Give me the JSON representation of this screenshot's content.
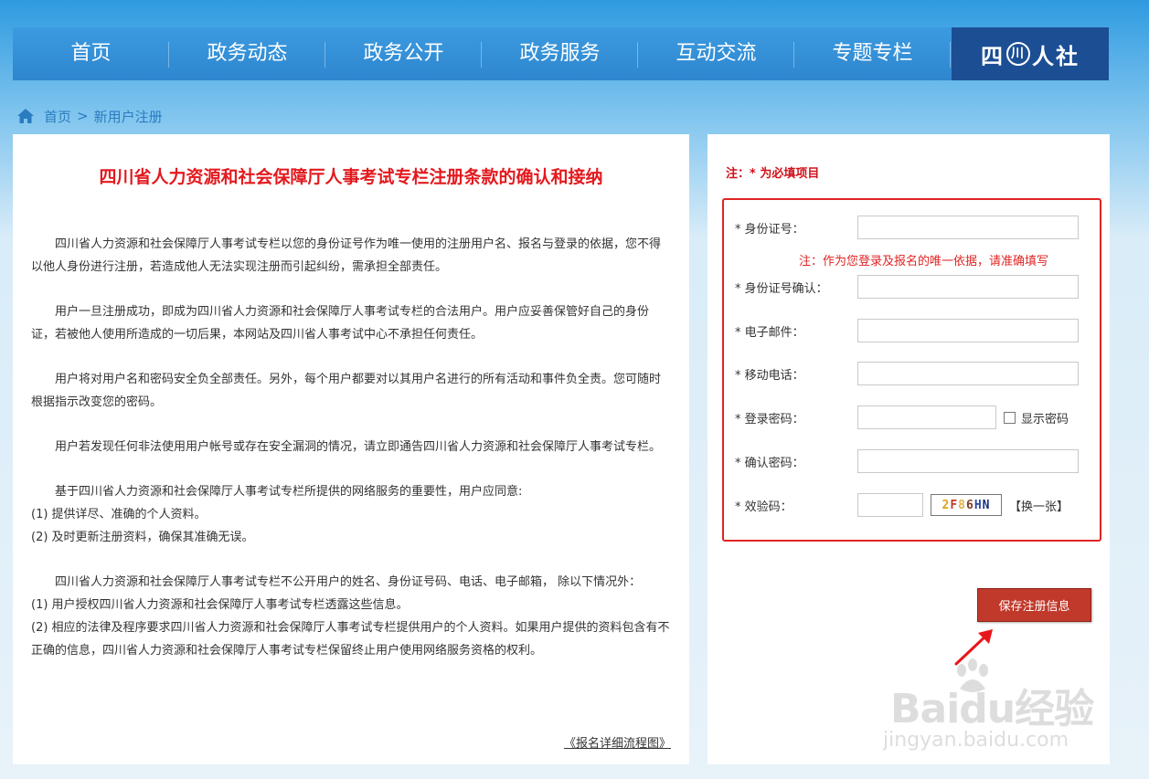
{
  "nav": {
    "items": [
      "首页",
      "政务动态",
      "政务公开",
      "政务服务",
      "互动交流",
      "专题专栏"
    ],
    "logo": {
      "pre": "四",
      "ring": "川",
      "post": "人社"
    }
  },
  "breadcrumb": {
    "home": "首页",
    "sep": ">",
    "current": "新用户注册"
  },
  "terms": {
    "title": "四川省人力资源和社会保障厅人事考试专栏注册条款的确认和接纳",
    "p1": "四川省人力资源和社会保障厅人事考试专栏以您的身份证号作为唯一使用的注册用户名、报名与登录的依据，您不得以他人身份进行注册，若造成他人无法实现注册而引起纠纷，需承担全部责任。",
    "p2": "用户一旦注册成功，即成为四川省人力资源和社会保障厅人事考试专栏的合法用户。用户应妥善保管好自己的身份证，若被他人使用所造成的一切后果，本网站及四川省人事考试中心不承担任何责任。",
    "p3": "用户将对用户名和密码安全负全部责任。另外，每个用户都要对以其用户名进行的所有活动和事件负全责。您可随时根据指示改变您的密码。",
    "p4": "用户若发现任何非法使用用户帐号或存在安全漏洞的情况，请立即通告四川省人力资源和社会保障厅人事考试专栏。",
    "p5": "基于四川省人力资源和社会保障厅人事考试专栏所提供的网络服务的重要性，用户应同意:",
    "p5a": "(1) 提供详尽、准确的个人资料。",
    "p5b": "(2) 及时更新注册资料，确保其准确无误。",
    "p6": "四川省人力资源和社会保障厅人事考试专栏不公开用户的姓名、身份证号码、电话、电子邮箱， 除以下情况外：",
    "p6a": "(1) 用户授权四川省人力资源和社会保障厅人事考试专栏透露这些信息。",
    "p6b": "(2) 相应的法律及程序要求四川省人力资源和社会保障厅人事考试专栏提供用户的个人资料。如果用户提供的资料包含有不正确的信息，四川省人力资源和社会保障厅人事考试专栏保留终止用户使用网络服务资格的权利。",
    "flow_link": "《报名详细流程图》"
  },
  "form": {
    "required_note": "注：* 为必填项目",
    "id_label": "* 身份证号：",
    "id_hint": "注：作为您登录及报名的唯一依据，请准确填写",
    "id_confirm_label": "* 身份证号确认：",
    "email_label": "* 电子邮件：",
    "mobile_label": "* 移动电话：",
    "password_label": "* 登录密码：",
    "show_password": "显示密码",
    "password_confirm_label": "* 确认密码：",
    "captcha_label": "* 效验码：",
    "captcha_chars": [
      "2",
      "F",
      "8",
      "6",
      "H",
      "N"
    ],
    "refresh": "【换一张】",
    "save": "保存注册信息"
  },
  "watermark": {
    "brand": "Baidu经验",
    "sub": "jingyan.baidu.com"
  },
  "colors": {
    "nav": "#2e86cf",
    "logo_bg": "#1c4e93",
    "title_red": "#e3191e",
    "button": "#c0392b"
  }
}
